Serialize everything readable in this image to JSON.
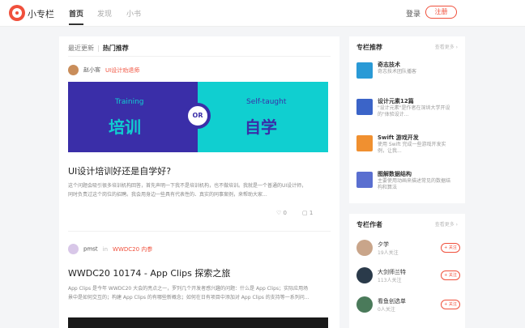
{
  "header": {
    "brand": "小专栏",
    "nav": [
      {
        "label": "首页",
        "active": true
      },
      {
        "label": "发现",
        "active": false
      },
      {
        "label": "小书",
        "active": false
      }
    ],
    "login": "登录",
    "register": "注册"
  },
  "feed": {
    "tabs": {
      "recent": "最近更新",
      "sep": "|",
      "hot": "热门推荐"
    },
    "posts": [
      {
        "author": "赵小客",
        "column": "UI设计劝退师",
        "banner": {
          "left_en": "Training",
          "left_cn": "培训",
          "or": "OR",
          "right_en": "Self-taught",
          "right_cn": "自学"
        },
        "title": "UI设计培训好还是自学好?",
        "summary": "这个问题会吸引很多培训机构回答，首先声明一下我不是培训机构，也不做培训。我就是一个普通的UI设计师，同时负责过这个岗位的招聘。我会用身边一些具有代表性的、真实的同事案例，来帮助大家...",
        "likes": "0",
        "comments": "1"
      },
      {
        "author": "pmst",
        "in_label": "in",
        "column": "WWDC20 内参",
        "title": "WWDC20 10174 - App Clips 探索之旅",
        "summary": "App Clips 是今年 WWDC20 大会的亮点之一，罗列几个开发者感兴趣的问题：什么是 App Clips；实际应用场景中是如何交互的；构建 App Clips 的有哪些新概念；如何在日有项目中添加对 App Clips 的支持等一系列问..."
      }
    ]
  },
  "sidebar": {
    "columns": {
      "title": "专栏推荐",
      "more": "查看更多 ›",
      "items": [
        {
          "name": "奇志技术",
          "desc": "奇志技术团队播客",
          "color": "#2a9ad6"
        },
        {
          "name": "设计元素12篇",
          "desc": "\"设计元素\"是作者在深圳大学开设的\"体验设计...",
          "color": "#3b64c8"
        },
        {
          "name": "Swift 游戏开发",
          "desc": "使用 Swift 完成一些游戏开发实例，让我...",
          "color": "#f09030"
        },
        {
          "name": "图解数据结构",
          "desc": "主要使用动画来描述常见的数据结构和算法",
          "color": "#5a6fd0"
        }
      ]
    },
    "authors": {
      "title": "专栏作者",
      "more": "查看更多 ›",
      "follow": "+ 关注",
      "items": [
        {
          "name": "夕学",
          "fans": "19人关注",
          "color": "#c9a58a"
        },
        {
          "name": "大剑师兰特",
          "fans": "113人关注",
          "color": "#2a3a4a"
        },
        {
          "name": "看鱼创选单",
          "fans": "0人关注",
          "color": "#4a7a5a"
        }
      ]
    }
  }
}
